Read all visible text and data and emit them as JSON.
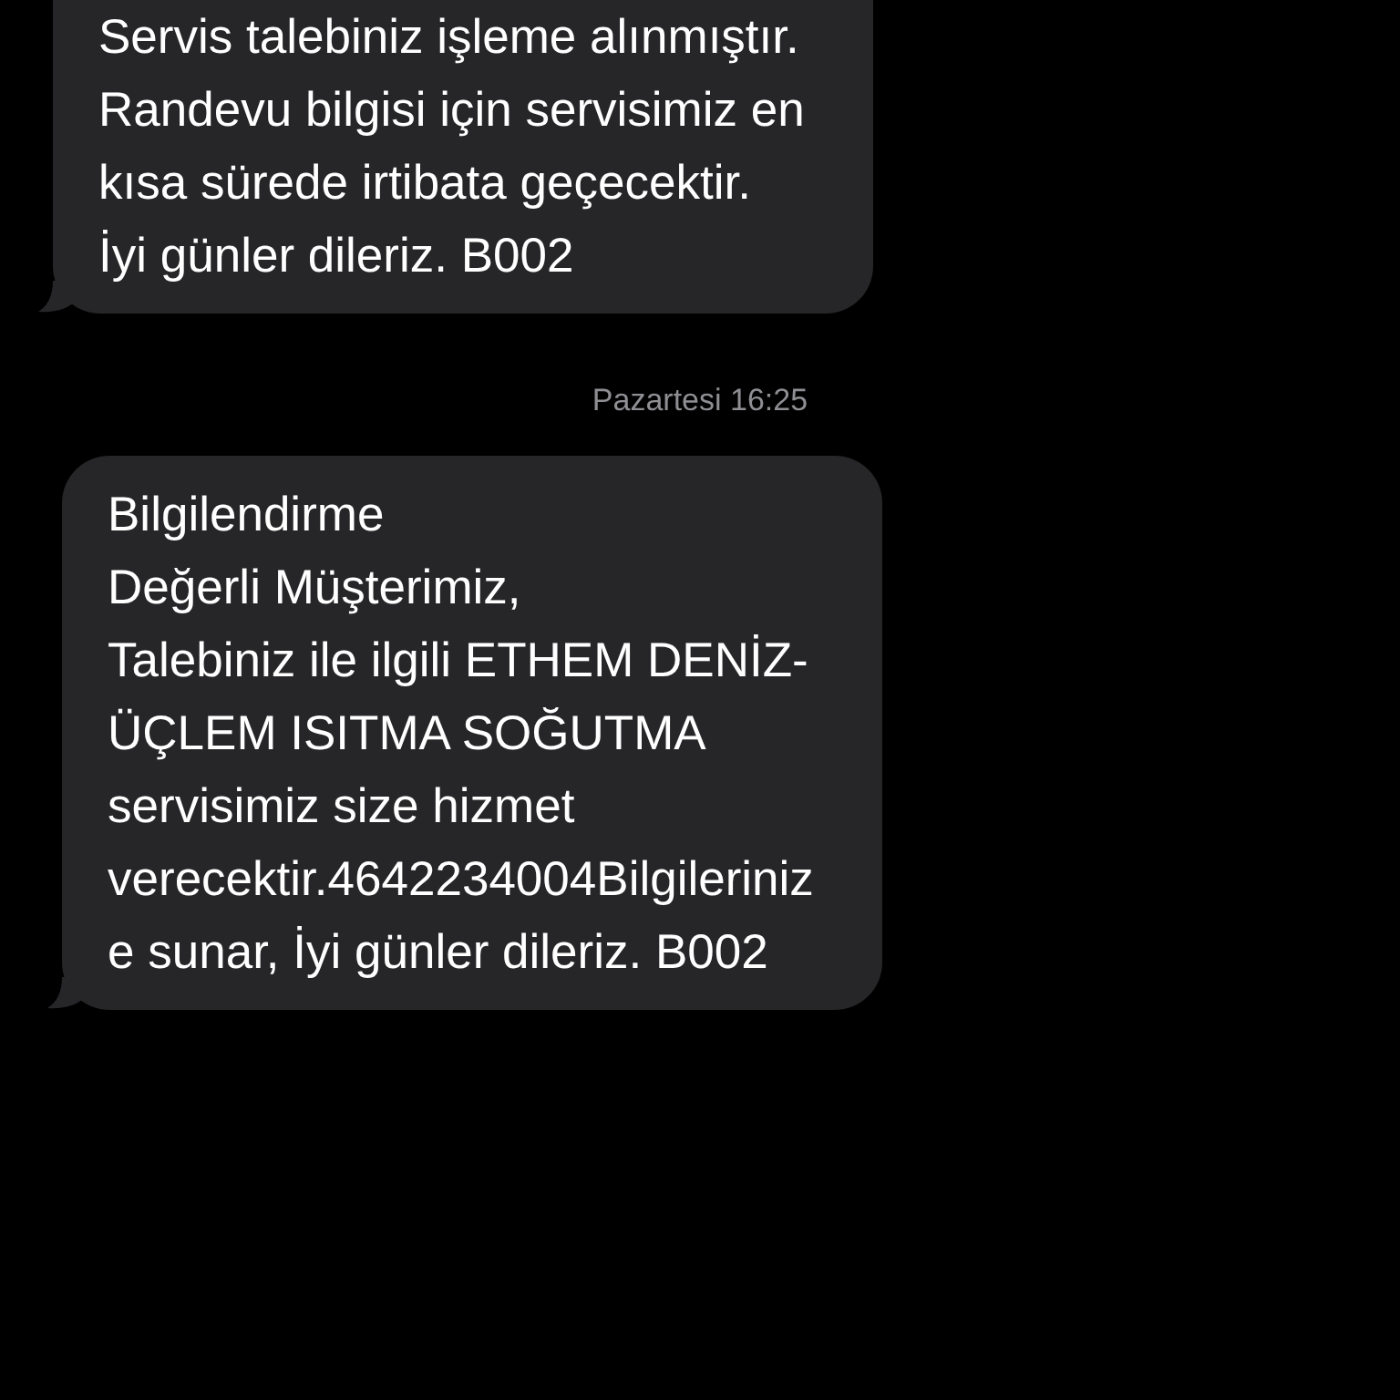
{
  "messages": [
    {
      "kind": "bubble",
      "text": "Servis talebiniz işleme alınmıştır.\nRandevu bilgisi için servisimiz en\nkısa sürede irtibata geçecektir.\nİyi günler dileriz. B002"
    },
    {
      "kind": "timestamp",
      "text": "Pazartesi 16:25"
    },
    {
      "kind": "bubble",
      "text": "Bilgilendirme\nDeğerli Müşterimiz,\nTalebiniz ile ilgili ETHEM DENİZ-\nÜÇLEM ISITMA SOĞUTMA\nservisimiz size hizmet\nverecektir.4642234004Bilgileriniz\ne sunar, İyi günler dileriz. B002"
    }
  ]
}
